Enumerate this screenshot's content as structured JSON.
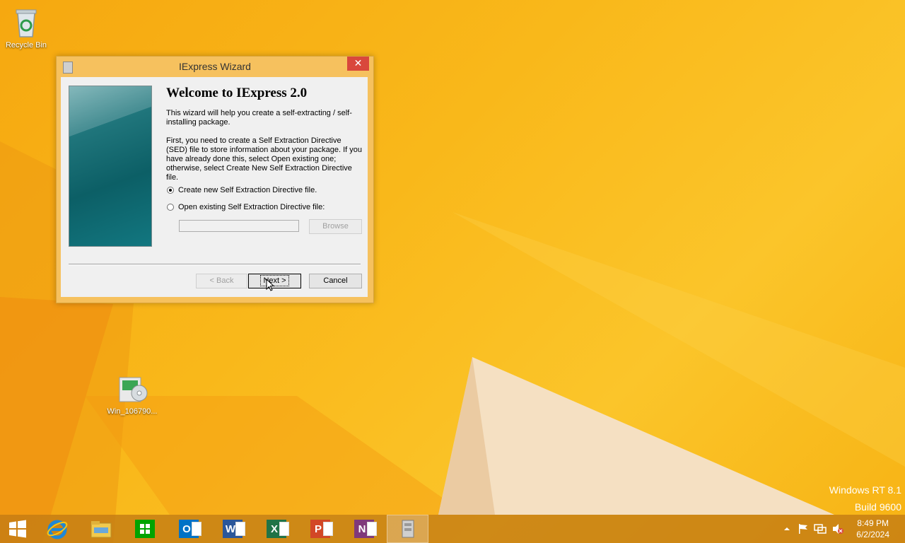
{
  "desktop": {
    "icons": [
      {
        "label": "Recycle Bin"
      },
      {
        "label": "Win_106790..."
      }
    ],
    "watermark": {
      "line1": "Windows RT 8.1",
      "line2": "Build 9600"
    }
  },
  "dialog": {
    "title": "IExpress Wizard",
    "close_glyph": "✕",
    "heading": "Welcome to IExpress 2.0",
    "intro": "This wizard will help you create a self-extracting / self-installing package.",
    "instructions": "First, you need to create a Self Extraction Directive (SED) file to store information about your package.  If you have already done this, select Open existing one; otherwise, select Create New Self Extraction Directive file.",
    "options": [
      {
        "label": "Create new Self Extraction Directive file.",
        "checked": true
      },
      {
        "label": "Open existing Self Extraction Directive file:",
        "checked": false
      }
    ],
    "path_value": "",
    "browse_label": "Browse",
    "back_label": "< Back",
    "next_label": "Next >",
    "cancel_label": "Cancel"
  },
  "taskbar": {
    "apps": [
      "start-icon",
      "internet-explorer-icon",
      "file-explorer-icon",
      "store-icon",
      "outlook-icon",
      "word-icon",
      "excel-icon",
      "powerpoint-icon",
      "onenote-icon",
      "iexpress-icon"
    ],
    "clock": {
      "time": "8:49 PM",
      "date": "6/2/2024"
    }
  },
  "colors": {
    "wallpaper": "#f9b81a",
    "dialog_frame": "#f6c15e",
    "close_button": "#d9473c",
    "word": "#2b579a",
    "excel": "#217346",
    "powerpoint": "#d24726",
    "onenote": "#80397b",
    "outlook": "#0072c6",
    "store": "#00a300"
  }
}
